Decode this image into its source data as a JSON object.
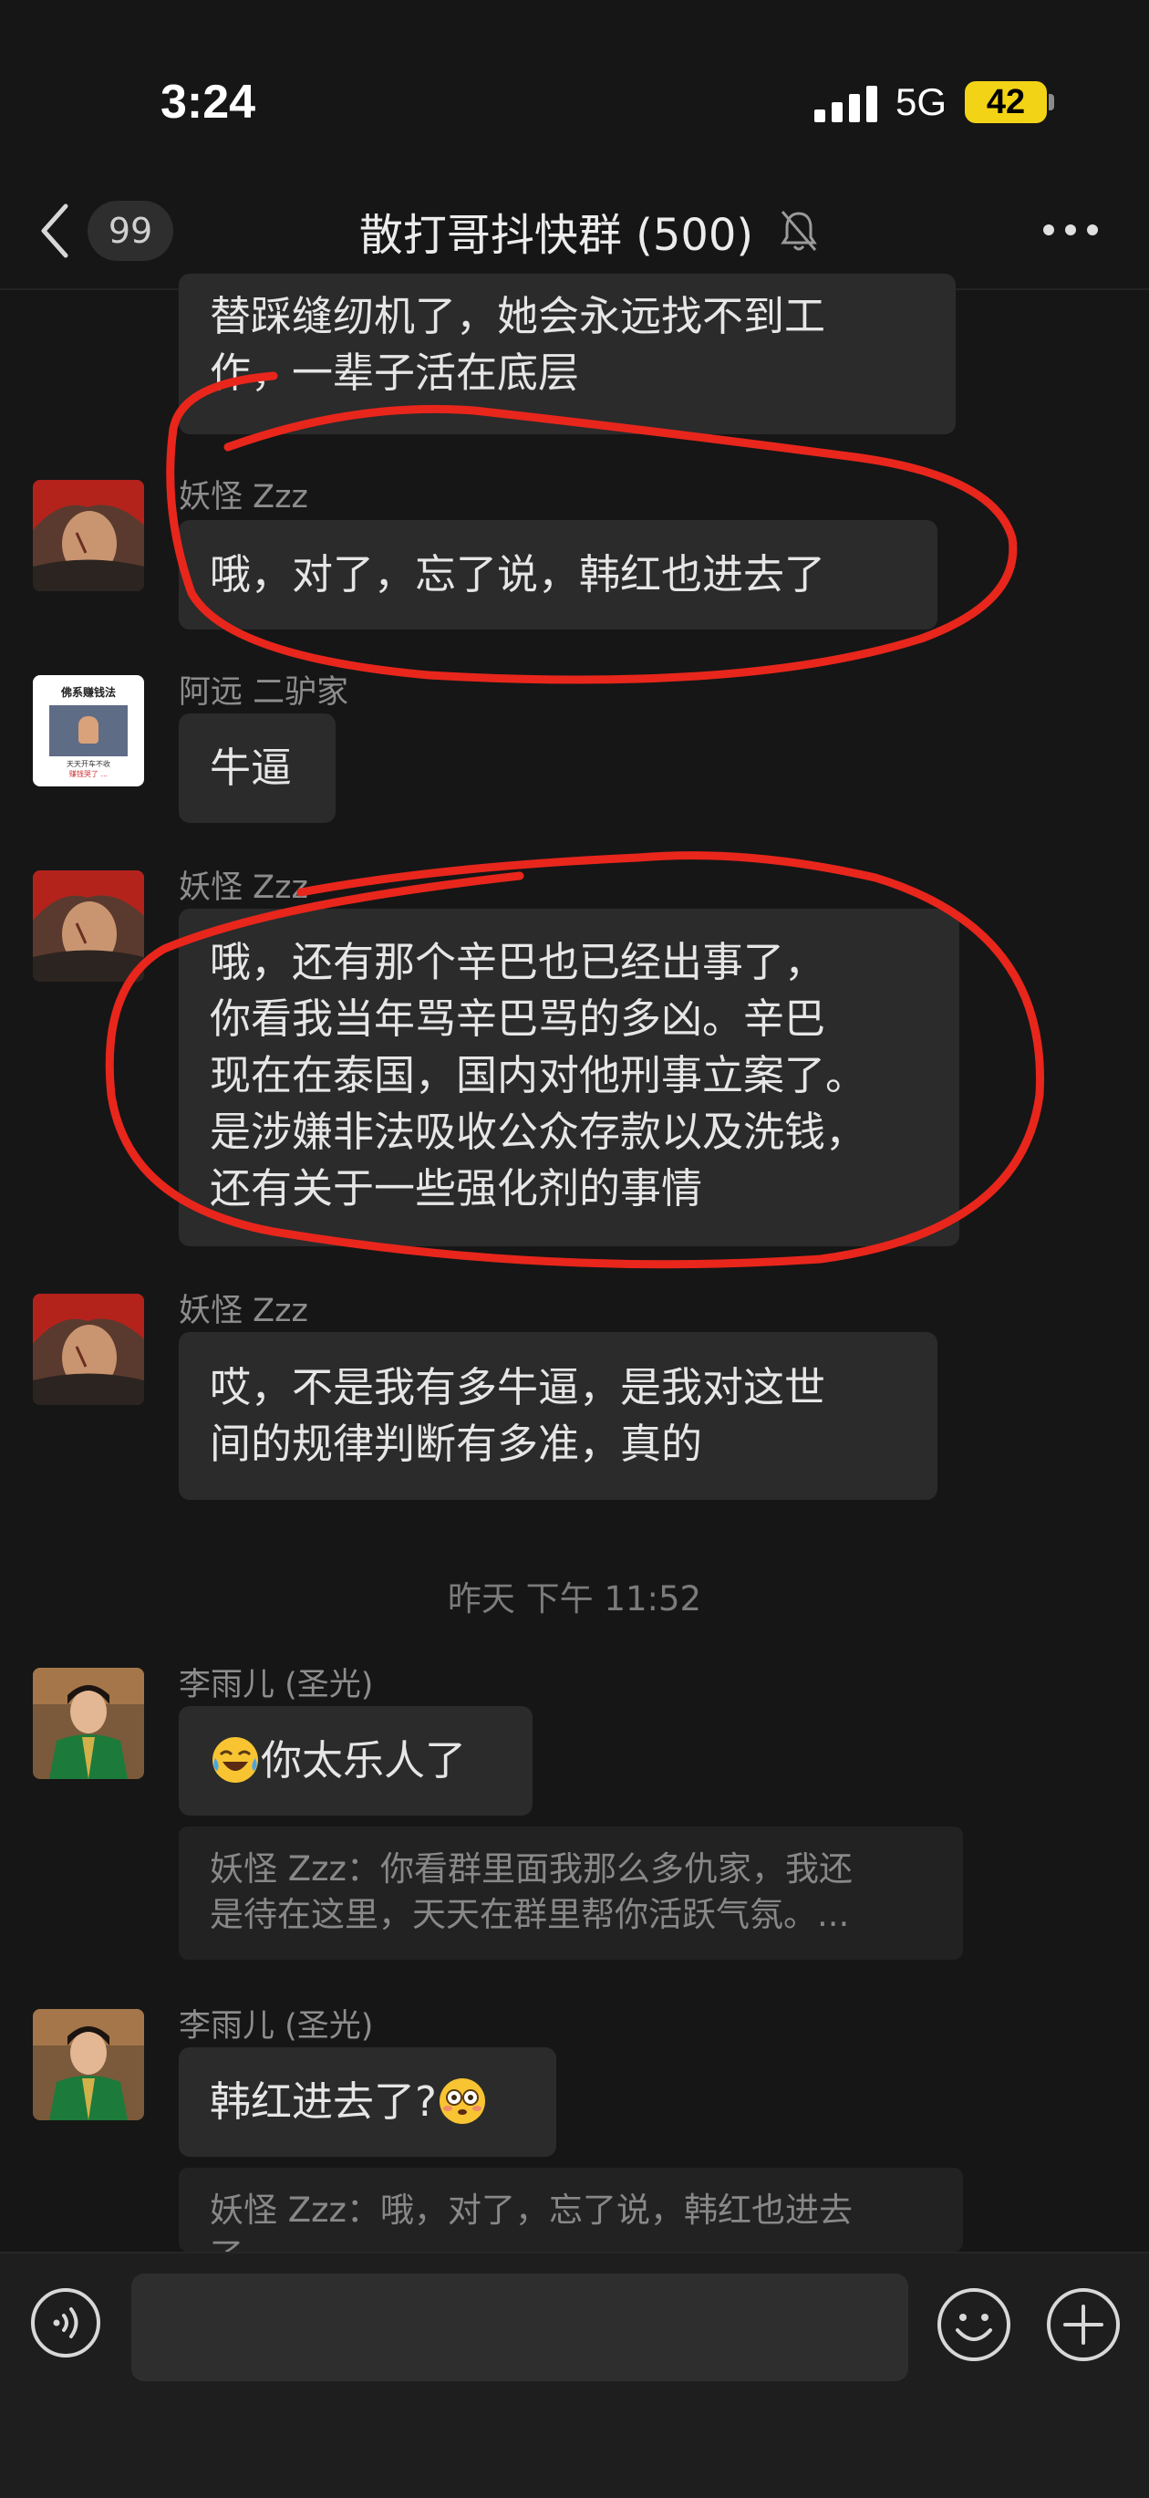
{
  "status_bar": {
    "time": "3:24",
    "network": "5G",
    "battery": "42"
  },
  "nav": {
    "back_count": "99",
    "title": "散打哥抖快群 (500)"
  },
  "messages": [
    {
      "type": "text",
      "sender": "",
      "lines": [
        "替踩缝纫机了，她会永远找不到工",
        "作，一辈子活在底层"
      ]
    },
    {
      "type": "text",
      "sender": "妖怪 Zzz",
      "lines": [
        "哦，对了，忘了说，韩红也进去了"
      ]
    },
    {
      "type": "text",
      "sender": "阿远 二驴家",
      "lines": [
        "牛逼"
      ]
    },
    {
      "type": "text",
      "sender": "妖怪 Zzz",
      "lines": [
        "哦，还有那个辛巴也已经出事了，",
        "你看我当年骂辛巴骂的多凶。辛巴",
        "现在在泰国，国内对他刑事立案了。",
        "是涉嫌非法吸收公众存款以及洗钱，",
        "还有关于一些强化剂的事情"
      ]
    },
    {
      "type": "text",
      "sender": "妖怪 Zzz",
      "lines": [
        "哎，不是我有多牛逼，是我对这世",
        "间的规律判断有多准，真的"
      ]
    },
    {
      "type": "timestamp",
      "text": "昨天 下午 11:52"
    },
    {
      "type": "text",
      "sender": "李雨儿 (圣光)",
      "lines": [
        "你太乐人了"
      ],
      "emoji": "crying-laughing-face",
      "quote": [
        "妖怪 Zzz：你看群里面我那么多仇家，我还",
        "是待在这里，天天在群里帮你活跃气氛。..."
      ]
    },
    {
      "type": "text",
      "sender": "李雨儿 (圣光)",
      "lines": [
        "韩红进去了?"
      ],
      "emoji": "flushed-face",
      "quote": [
        "妖怪 Zzz：哦，对了，忘了说，韩红也进去",
        "了"
      ]
    }
  ],
  "avatar_thumbnail_text": [
    "佛系赚钱法",
    "天天开车不收",
    "赚钱哭了 ..."
  ],
  "icons": [
    "back-chevron-icon",
    "mute-bell-icon",
    "more-icon",
    "voice-icon",
    "emoji-icon",
    "plus-icon"
  ],
  "colors": {
    "background": "#161616",
    "bubble": "#2b2b2b",
    "annotation": "#e8261c",
    "battery": "#f3d316"
  }
}
